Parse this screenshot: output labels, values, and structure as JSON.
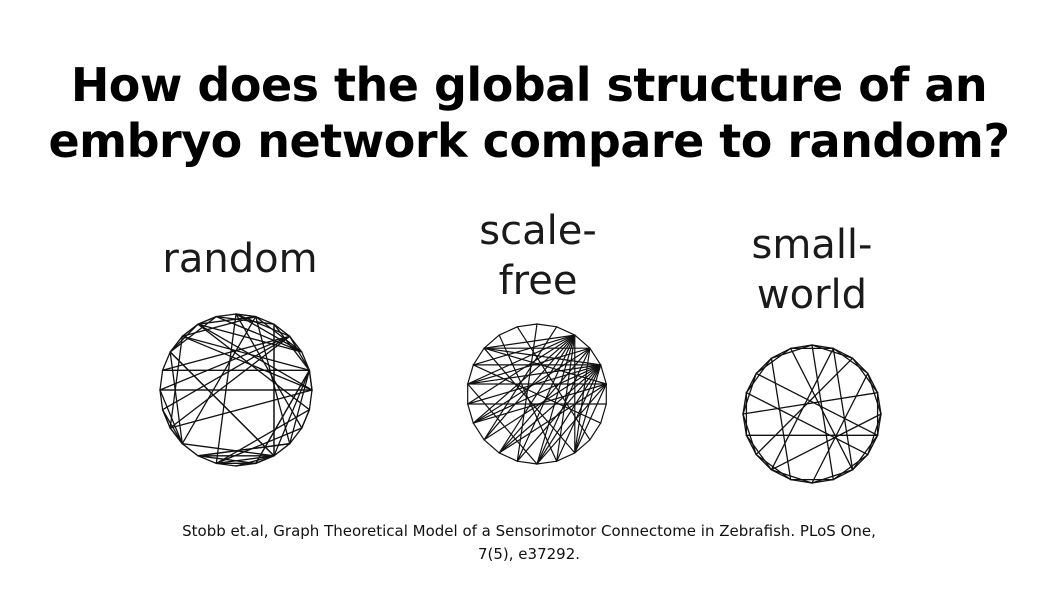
{
  "title": {
    "line1": "How does the global structure of an",
    "line2": "embryo network compare to random?"
  },
  "networks": [
    {
      "label_lines": [
        "random"
      ]
    },
    {
      "label_lines": [
        "scale-",
        "free"
      ]
    },
    {
      "label_lines": [
        "small-",
        "world"
      ]
    }
  ],
  "citation": {
    "line1": "Stobb et.al, Graph Theoretical Model of a Sensorimotor Connectome in Zebrafish. PLoS One,",
    "line2": "7(5), e37292."
  }
}
